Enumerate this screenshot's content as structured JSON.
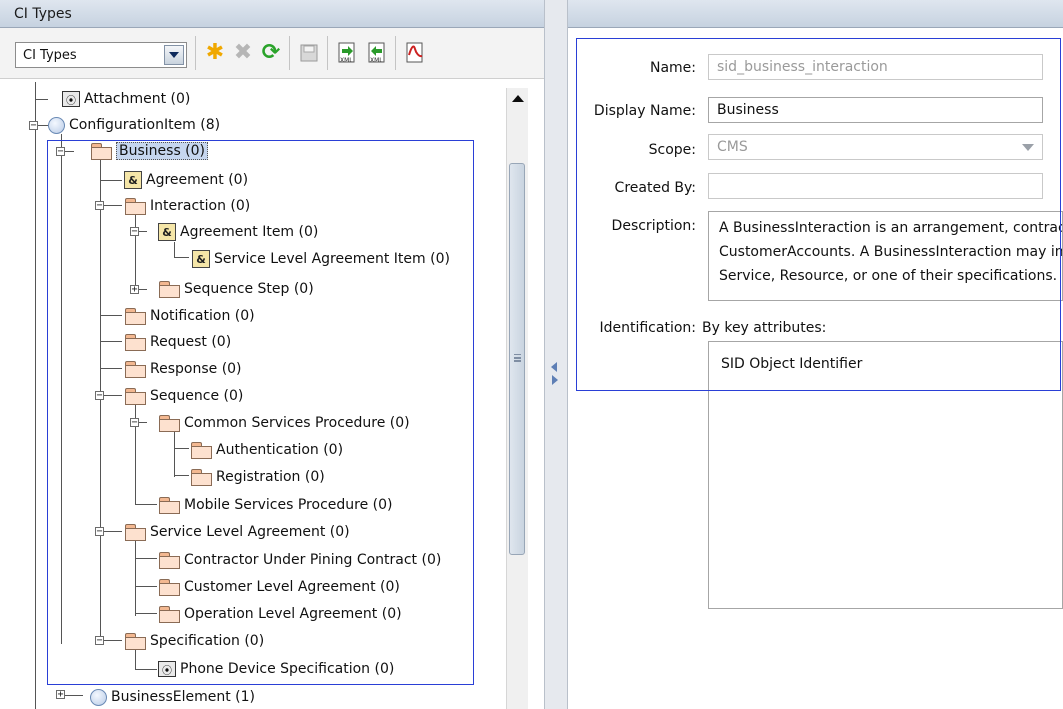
{
  "left_panel": {
    "title": "CI Types",
    "toolbar": {
      "dropdown_value": "CI Types",
      "icons": [
        "new-star-icon",
        "delete-x-icon",
        "refresh-icon",
        "save-icon",
        "import-xml-icon",
        "export-xml-icon",
        "export-pdf-icon"
      ]
    },
    "tree": {
      "attachment": "Attachment (0)",
      "configuration_item": "ConfigurationItem (8)",
      "business": "Business (0)",
      "agreement": "Agreement (0)",
      "interaction": "Interaction (0)",
      "agreement_item": "Agreement Item (0)",
      "service_level_agreement_item": "Service Level Agreement Item (0)",
      "sequence_step": "Sequence Step (0)",
      "notification": "Notification (0)",
      "request": "Request (0)",
      "response": "Response (0)",
      "sequence": "Sequence (0)",
      "common_services_procedure": "Common Services Procedure (0)",
      "authentication": "Authentication (0)",
      "registration": "Registration (0)",
      "mobile_services_procedure": "Mobile Services Procedure (0)",
      "service_level_agreement": "Service Level Agreement (0)",
      "contractor_under_pining_contract": "Contractor Under Pining Contract (0)",
      "customer_level_agreement": "Customer Level Agreement (0)",
      "operation_level_agreement": "Operation Level Agreement (0)",
      "specification": "Specification (0)",
      "phone_device_specification": "Phone Device Specification (0)",
      "business_element": "BusinessElement (1)"
    }
  },
  "right_panel": {
    "name_label": "Name:",
    "name_value": "sid_business_interaction",
    "display_name_label": "Display Name:",
    "display_name_value": "Business",
    "scope_label": "Scope:",
    "scope_value": "CMS",
    "created_by_label": "Created By:",
    "created_by_value": "",
    "description_label": "Description:",
    "description_lines": [
      "A BusinessInteraction is an arrangement, contract, communication or joint activity between one or more PartyRoles,",
      "CustomerAccounts.  A BusinessInteraction may involve a specific Product, ProductOffering, and may also involve a",
      "Service, Resource, or one of their specifications."
    ],
    "identification_label": "Identification:",
    "identification_mode": "By key attributes:",
    "identification_value": "SID Object Identifier"
  }
}
